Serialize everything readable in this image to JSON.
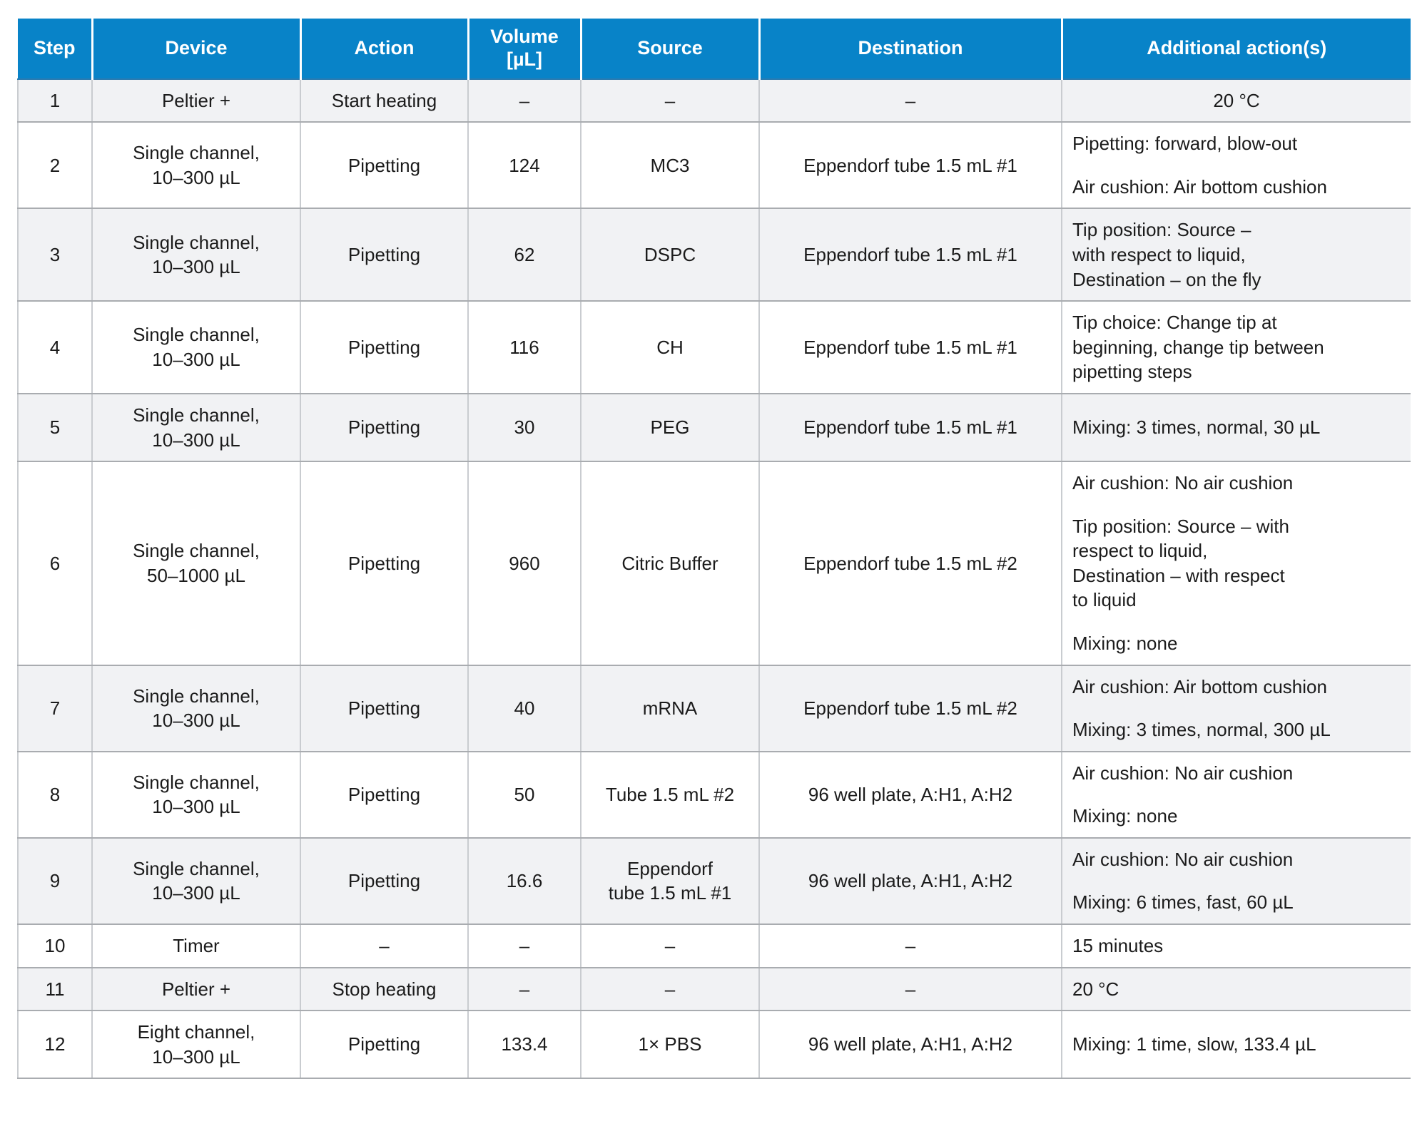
{
  "table": {
    "columns": [
      {
        "key": "step",
        "label": "Step"
      },
      {
        "key": "device",
        "label": "Device"
      },
      {
        "key": "action",
        "label": "Action"
      },
      {
        "key": "volume",
        "label_line1": "Volume",
        "label_line2": "[µL]"
      },
      {
        "key": "source",
        "label": "Source"
      },
      {
        "key": "destination",
        "label": "Destination"
      },
      {
        "key": "additional",
        "label": "Additional action(s)"
      }
    ],
    "rows": [
      {
        "step": "1",
        "device": "Peltier +",
        "action": "Start heating",
        "volume": "–",
        "source": "–",
        "destination": "–",
        "additional": [
          "20 °C"
        ],
        "additional_align": "center"
      },
      {
        "step": "2",
        "device_line1": "Single channel,",
        "device_line2": "10–300 µL",
        "action": "Pipetting",
        "volume": "124",
        "source": "MC3",
        "destination": "Eppendorf tube 1.5 mL #1",
        "additional": [
          "Pipetting: forward, blow-out",
          "",
          "Air cushion: Air bottom cushion"
        ]
      },
      {
        "step": "3",
        "device_line1": "Single channel,",
        "device_line2": "10–300 µL",
        "action": "Pipetting",
        "volume": "62",
        "source": "DSPC",
        "destination": "Eppendorf tube 1.5 mL #1",
        "additional": [
          "Tip position: Source –",
          "with respect to liquid,",
          "Destination – on the fly"
        ]
      },
      {
        "step": "4",
        "device_line1": "Single channel,",
        "device_line2": "10–300 µL",
        "action": "Pipetting",
        "volume": "116",
        "source": "CH",
        "destination": "Eppendorf tube 1.5 mL #1",
        "additional": [
          "Tip choice: Change tip at",
          "beginning, change tip between",
          "pipetting steps"
        ]
      },
      {
        "step": "5",
        "device_line1": "Single channel,",
        "device_line2": "10–300 µL",
        "action": "Pipetting",
        "volume": "30",
        "source": "PEG",
        "destination": "Eppendorf tube 1.5 mL #1",
        "additional": [
          "Mixing: 3 times, normal, 30 µL"
        ]
      },
      {
        "step": "6",
        "device_line1": "Single channel,",
        "device_line2": "50–1000 µL",
        "action": "Pipetting",
        "volume": "960",
        "source": "Citric Buffer",
        "destination": "Eppendorf tube 1.5 mL #2",
        "additional": [
          "Air cushion: No air cushion",
          "",
          "Tip position: Source – with",
          "respect to liquid,",
          "Destination – with respect",
          "to liquid",
          "",
          "Mixing: none"
        ]
      },
      {
        "step": "7",
        "device_line1": "Single channel,",
        "device_line2": "10–300 µL",
        "action": "Pipetting",
        "volume": "40",
        "source": "mRNA",
        "destination": "Eppendorf tube 1.5 mL #2",
        "additional": [
          "Air cushion: Air bottom cushion",
          "",
          "Mixing: 3 times, normal, 300 µL"
        ]
      },
      {
        "step": "8",
        "device_line1": "Single channel,",
        "device_line2": "10–300 µL",
        "action": "Pipetting",
        "volume": "50",
        "source": "Tube 1.5 mL #2",
        "destination": "96 well plate, A:H1, A:H2",
        "additional": [
          "Air cushion: No air cushion",
          "",
          "Mixing: none"
        ]
      },
      {
        "step": "9",
        "device_line1": "Single channel,",
        "device_line2": "10–300 µL",
        "action": "Pipetting",
        "volume": "16.6",
        "source_line1": "Eppendorf",
        "source_line2": "tube 1.5 mL #1",
        "destination": "96 well plate, A:H1, A:H2",
        "additional": [
          "Air cushion: No air cushion",
          "",
          "Mixing: 6 times, fast, 60 µL"
        ]
      },
      {
        "step": "10",
        "device": "Timer",
        "action": "–",
        "volume": "–",
        "source": "–",
        "destination": "–",
        "additional": [
          "15 minutes"
        ]
      },
      {
        "step": "11",
        "device": "Peltier +",
        "action": "Stop heating",
        "volume": "–",
        "source": "–",
        "destination": "–",
        "additional": [
          "20 °C"
        ]
      },
      {
        "step": "12",
        "device_line1": "Eight channel,",
        "device_line2": "10–300 µL",
        "action": "Pipetting",
        "volume": "133.4",
        "source": "1× PBS",
        "destination": "96 well plate, A:H1, A:H2",
        "additional": [
          "Mixing: 1 time, slow, 133.4 µL"
        ]
      }
    ]
  },
  "colors": {
    "header_blue": "#0883c8",
    "header_text": "#ffffff",
    "row_alt": "#f1f2f4",
    "row_plain": "#ffffff",
    "grid_line": "#a9acb0",
    "body_text": "#1b1b1b"
  }
}
